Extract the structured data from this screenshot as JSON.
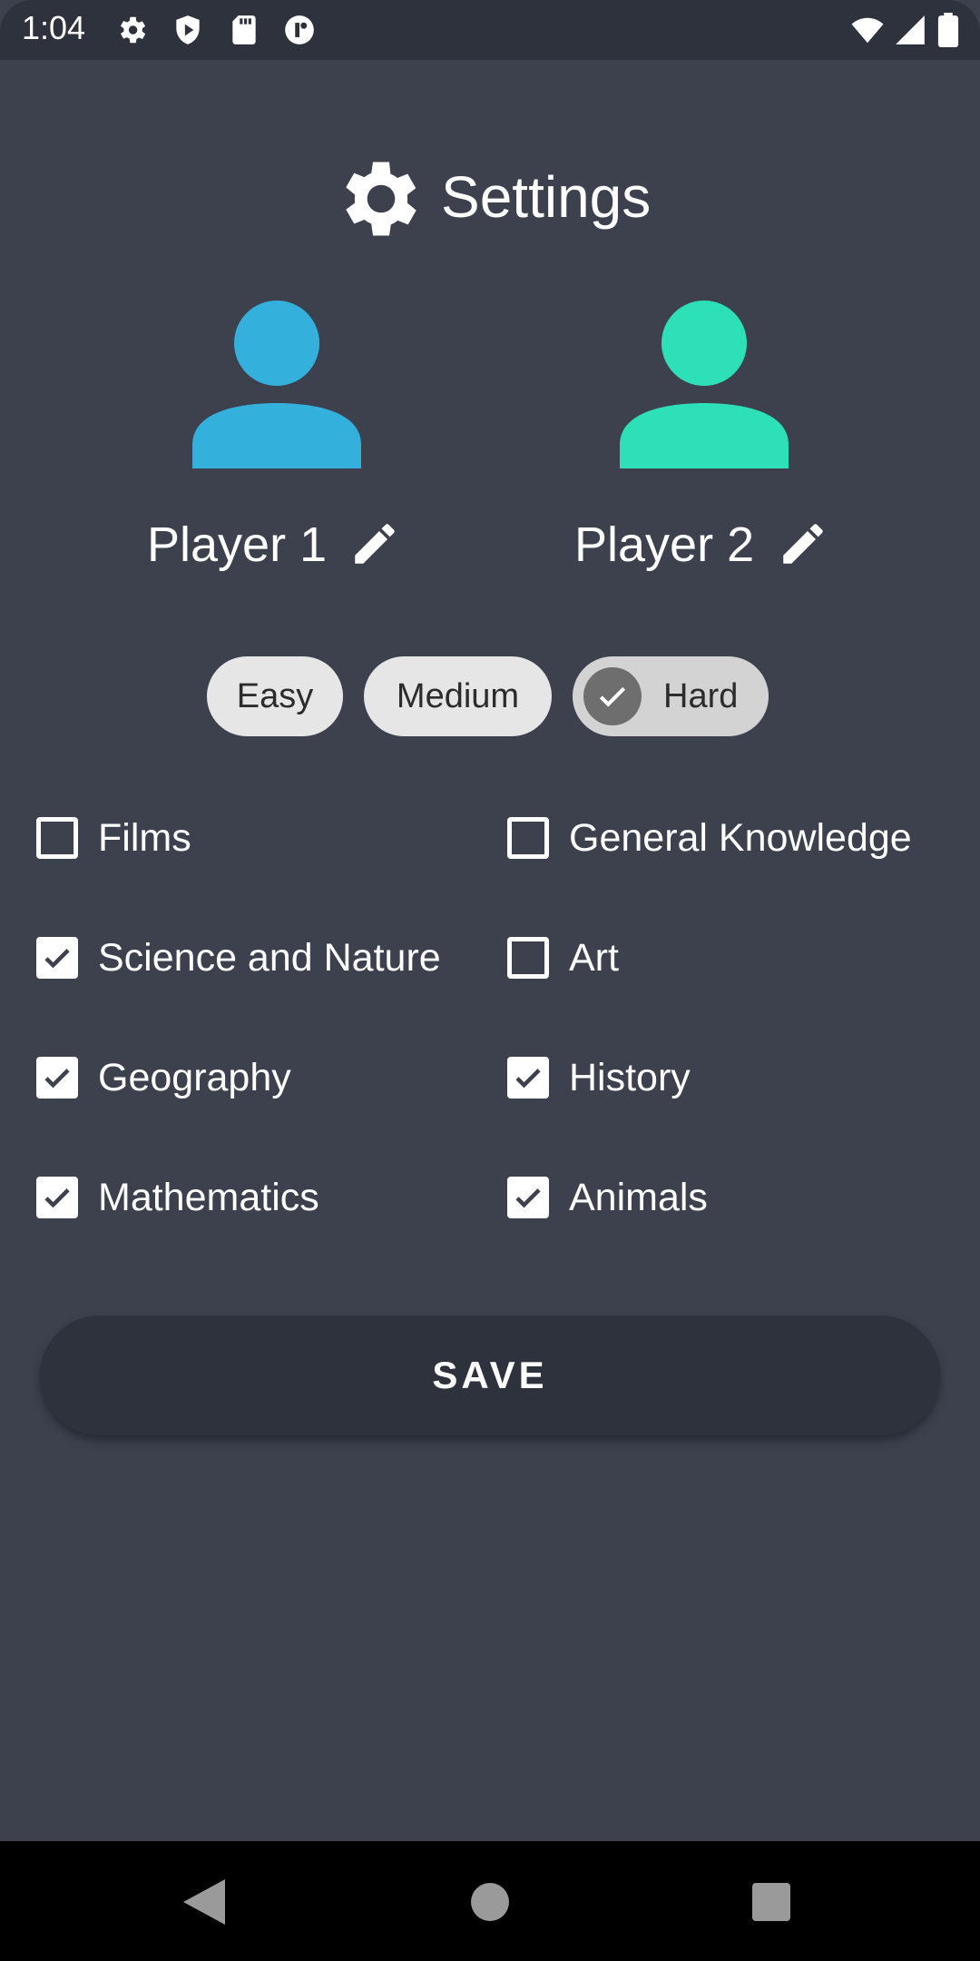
{
  "status_bar": {
    "time": "1:04",
    "left_icons": [
      "gear-icon",
      "shield-play-icon",
      "sd-card-icon",
      "circle-badge-icon"
    ],
    "right_icons": [
      "wifi-icon",
      "signal-icon",
      "battery-icon"
    ]
  },
  "header": {
    "title": "Settings",
    "icon": "gear-icon"
  },
  "players": [
    {
      "name": "Player 1",
      "avatar_color": "#34b0dc"
    },
    {
      "name": "Player 2",
      "avatar_color": "#2ee0b8"
    }
  ],
  "difficulty": {
    "options": [
      "Easy",
      "Medium",
      "Hard"
    ],
    "selected": "Hard"
  },
  "categories": [
    {
      "label": "Films",
      "checked": false
    },
    {
      "label": "General Knowledge",
      "checked": false
    },
    {
      "label": "Science and Nature",
      "checked": true
    },
    {
      "label": "Art",
      "checked": false
    },
    {
      "label": "Geography",
      "checked": true
    },
    {
      "label": "History",
      "checked": true
    },
    {
      "label": "Mathematics",
      "checked": true
    },
    {
      "label": "Animals",
      "checked": true
    }
  ],
  "save_label": "SAVE",
  "colors": {
    "background": "#3c414d",
    "dark": "#2d323d",
    "accent_p1": "#34b0dc",
    "accent_p2": "#2ee0b8"
  }
}
